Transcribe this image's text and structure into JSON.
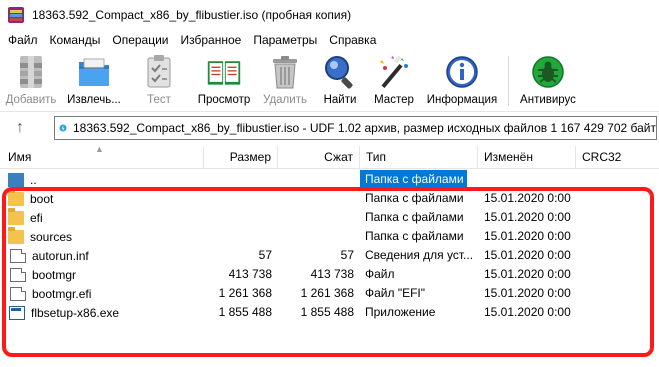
{
  "window": {
    "title": "18363.592_Compact_x86_by_flibustier.iso (пробная копия)"
  },
  "menu": {
    "items": [
      "Файл",
      "Команды",
      "Операции",
      "Избранное",
      "Параметры",
      "Справка"
    ]
  },
  "toolbar": {
    "buttons": [
      {
        "label": "Добавить",
        "icon": "add-archive-icon",
        "enabled": false
      },
      {
        "label": "Извлечь...",
        "icon": "extract-icon",
        "enabled": true
      },
      {
        "label": "Тест",
        "icon": "test-icon",
        "enabled": false
      },
      {
        "label": "Просмотр",
        "icon": "view-book-icon",
        "enabled": true
      },
      {
        "label": "Удалить",
        "icon": "trash-icon",
        "enabled": false
      },
      {
        "label": "Найти",
        "icon": "find-magnifier-icon",
        "enabled": true
      },
      {
        "label": "Мастер",
        "icon": "wizard-wand-icon",
        "enabled": true
      },
      {
        "label": "Информация",
        "icon": "info-icon",
        "enabled": true
      },
      {
        "label": "Антивирус",
        "icon": "antivirus-bug-icon",
        "enabled": true
      }
    ]
  },
  "address": {
    "text": "18363.592_Compact_x86_by_flibustier.iso - UDF 1.02 архив, размер исходных файлов 1 167 429 702 байт"
  },
  "columns": {
    "name": "Имя",
    "size": "Размер",
    "packed": "Сжат",
    "type": "Тип",
    "modified": "Изменён",
    "crc": "CRC32"
  },
  "files": [
    {
      "name": "..",
      "size": "",
      "packed": "",
      "type": "Папка с файлами",
      "modified": "",
      "icon": "parent-folder-icon"
    },
    {
      "name": "boot",
      "size": "",
      "packed": "",
      "type": "Папка с файлами",
      "modified": "15.01.2020 0:00",
      "icon": "folder-icon"
    },
    {
      "name": "efi",
      "size": "",
      "packed": "",
      "type": "Папка с файлами",
      "modified": "15.01.2020 0:00",
      "icon": "folder-icon"
    },
    {
      "name": "sources",
      "size": "",
      "packed": "",
      "type": "Папка с файлами",
      "modified": "15.01.2020 0:00",
      "icon": "folder-icon"
    },
    {
      "name": "autorun.inf",
      "size": "57",
      "packed": "57",
      "type": "Сведения для уст...",
      "modified": "15.01.2020 0:00",
      "icon": "settings-file-icon"
    },
    {
      "name": "bootmgr",
      "size": "413 738",
      "packed": "413 738",
      "type": "Файл",
      "modified": "15.01.2020 0:00",
      "icon": "file-icon"
    },
    {
      "name": "bootmgr.efi",
      "size": "1 261 368",
      "packed": "1 261 368",
      "type": "Файл \"EFI\"",
      "modified": "15.01.2020 0:00",
      "icon": "file-icon"
    },
    {
      "name": "flbsetup-x86.exe",
      "size": "1 855 488",
      "packed": "1 855 488",
      "type": "Приложение",
      "modified": "15.01.2020 0:00",
      "icon": "exe-file-icon"
    }
  ],
  "colors": {
    "selection": "#0078d7",
    "highlight_frame": "#ff1a1a"
  }
}
